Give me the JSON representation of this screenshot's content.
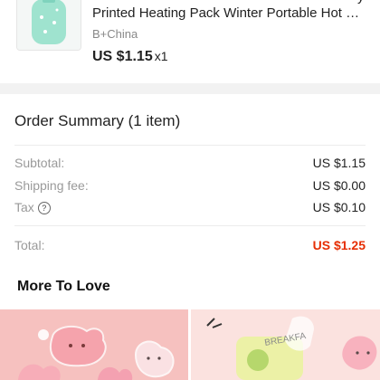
{
  "product": {
    "title": "Printed Heating Pack Winter Portable Hot W...",
    "title_clip": "y",
    "ship_from": "B+China",
    "price": "US $1.15",
    "quantity": "x1"
  },
  "summary": {
    "title": "Order Summary (1 item)",
    "rows": [
      {
        "label": "Subtotal:",
        "value": "US $1.15"
      },
      {
        "label": "Shipping fee:",
        "value": "US $0.00"
      },
      {
        "label": "Tax",
        "value": "US $0.10"
      }
    ],
    "tax_help_glyph": "?",
    "total_label": "Total:",
    "total_value": "US $1.25"
  },
  "recommendations": {
    "title": "More To Love",
    "right_tile_text": "BREAKFA"
  },
  "colors": {
    "accent_price": "#e62e04",
    "separator": "#f2f2f2",
    "muted_text": "#9a9a9a"
  }
}
